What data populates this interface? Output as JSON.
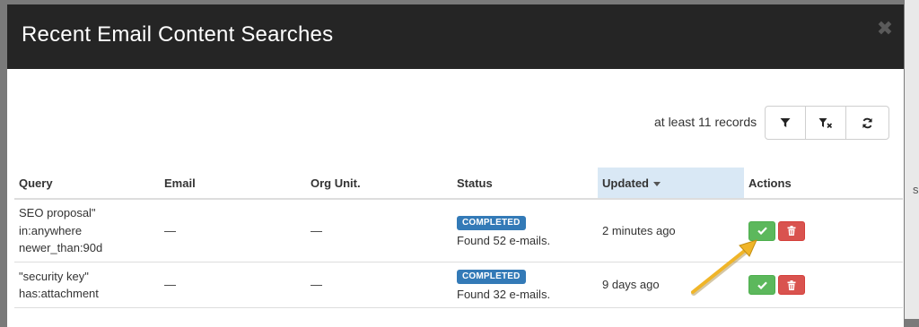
{
  "modal": {
    "title": "Recent Email Content Searches"
  },
  "toolbar": {
    "records_text": "at least 11 records",
    "buttons": [
      "filter-icon",
      "clear-filter-icon",
      "refresh-icon"
    ]
  },
  "table": {
    "columns": [
      "Query",
      "Email",
      "Org Unit.",
      "Status",
      "Updated",
      "Actions"
    ],
    "sorted_column": "Updated",
    "rows": [
      {
        "query": [
          "SEO proposal\"",
          "in:anywhere",
          "newer_than:90d"
        ],
        "email": "—",
        "org_unit": "—",
        "status_badge": "COMPLETED",
        "status_text": "Found 52 e-mails.",
        "updated": "2 minutes ago"
      },
      {
        "query": [
          "\"security key\"",
          "has:attachment"
        ],
        "email": "—",
        "org_unit": "—",
        "status_badge": "COMPLETED",
        "status_text": "Found 32 e-mails.",
        "updated": "9 days ago"
      }
    ]
  },
  "colors": {
    "header_bg": "#252525",
    "badge_blue": "#337ab7",
    "approve_green": "#5cb85c",
    "delete_red": "#d9534f",
    "arrow_yellow": "#f0b528"
  },
  "background_peek": "s"
}
